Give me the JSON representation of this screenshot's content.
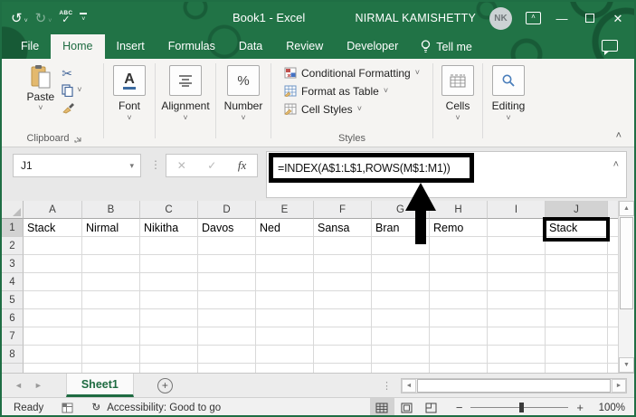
{
  "window": {
    "title": "Book1  -  Excel",
    "user_name": "NIRMAL KAMISHETTY",
    "user_initials": "NK"
  },
  "ribbon_tabs": {
    "file": "File",
    "home": "Home",
    "insert": "Insert",
    "formulas": "Formulas",
    "data": "Data",
    "review": "Review",
    "developer": "Developer",
    "tell_me": "Tell me"
  },
  "ribbon": {
    "clipboard": {
      "paste": "Paste",
      "label": "Clipboard"
    },
    "font": {
      "label": "Font"
    },
    "alignment": {
      "label": "Alignment"
    },
    "number": {
      "label": "Number"
    },
    "styles": {
      "conditional_formatting": "Conditional Formatting",
      "format_as_table": "Format as Table",
      "cell_styles": "Cell Styles",
      "label": "Styles"
    },
    "cells": {
      "label": "Cells"
    },
    "editing": {
      "label": "Editing"
    }
  },
  "formula_bar": {
    "name_box": "J1",
    "formula": "=INDEX(A$1:L$1,ROWS(M$1:M1))",
    "fx_label": "fx"
  },
  "grid": {
    "columns": [
      "A",
      "B",
      "C",
      "D",
      "E",
      "F",
      "G",
      "H",
      "I",
      "J"
    ],
    "rows": [
      "1",
      "2",
      "3",
      "4",
      "5",
      "6",
      "7",
      "8"
    ],
    "cells": {
      "A1": "Stack",
      "B1": "Nirmal",
      "C1": "Nikitha",
      "D1": "Davos",
      "E1": "Ned",
      "F1": "Sansa",
      "G1": "Bran",
      "H1": "Remo",
      "J1": "Stack"
    },
    "selected_cell": "J1",
    "selected_col": "J",
    "selected_row": "1"
  },
  "sheet_tabs": {
    "active": "Sheet1"
  },
  "status_bar": {
    "mode": "Ready",
    "accessibility": "Accessibility: Good to go",
    "zoom_level": "100%"
  },
  "glyphs": {
    "undo": "↺",
    "redo": "↻",
    "spellcheck_text": "ABC",
    "check": "✓",
    "minimize": "—",
    "close": "✕",
    "chevron_down": "˅",
    "chevron_up": "˄",
    "dropdown_arrow": "▾",
    "cancel": "✕",
    "fx": "fx",
    "scissors": "✂",
    "percent": "%",
    "font_a": "A",
    "dots_vertical": "⋮",
    "nav_left": "◄",
    "nav_right": "►",
    "scroll_up": "▲",
    "scroll_down": "▼",
    "plus": "+",
    "minus": "−",
    "accessibility_circle": "↻"
  },
  "colors": {
    "excel_green": "#217346",
    "annotation_black": "#000000"
  }
}
